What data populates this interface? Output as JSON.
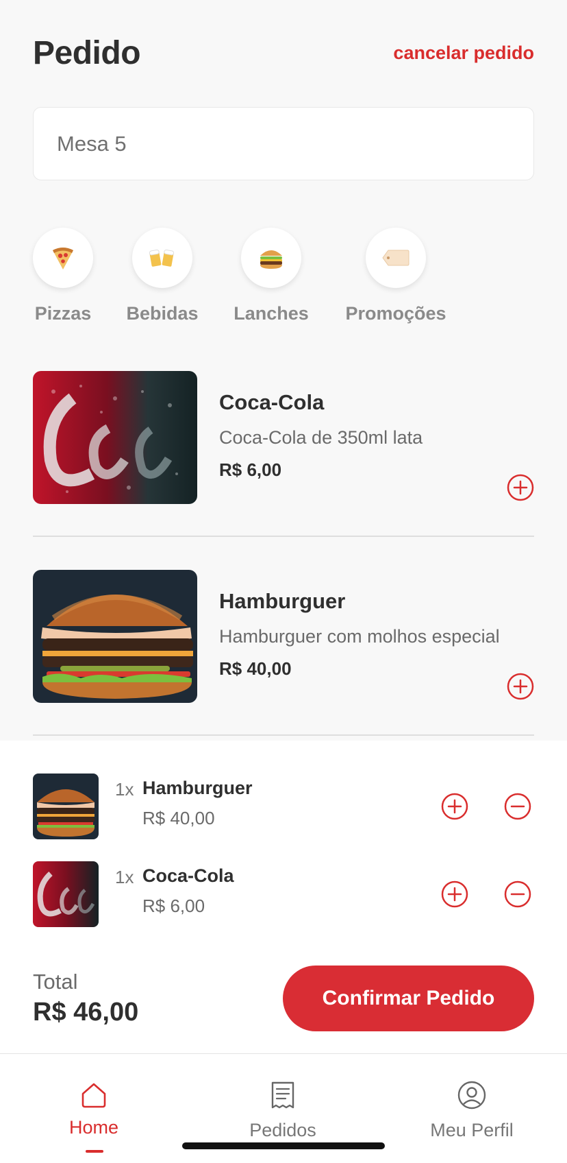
{
  "header": {
    "title": "Pedido",
    "cancel_label": "cancelar pedido"
  },
  "table_field": {
    "value": "Mesa 5"
  },
  "categories": [
    {
      "label": "Pizzas",
      "icon": "pizza-icon"
    },
    {
      "label": "Bebidas",
      "icon": "beer-mugs-icon"
    },
    {
      "label": "Lanches",
      "icon": "burger-icon"
    },
    {
      "label": "Promoções",
      "icon": "tag-icon"
    }
  ],
  "products": [
    {
      "name": "Coca-Cola",
      "description": "Coca-Cola de 350ml lata",
      "price": "R$ 6,00",
      "image": "coca-cola-can-image"
    },
    {
      "name": "Hamburguer",
      "description": "Hamburguer com molhos especial",
      "price": "R$ 40,00",
      "image": "hamburger-image"
    }
  ],
  "cart": {
    "items": [
      {
        "qty": "1x",
        "name": "Hamburguer",
        "price": "R$ 40,00"
      },
      {
        "qty": "1x",
        "name": "Coca-Cola",
        "price": "R$ 6,00"
      }
    ],
    "total_label": "Total",
    "total_value": "R$ 46,00",
    "confirm_label": "Confirmar Pedido"
  },
  "navbar": {
    "items": [
      {
        "label": "Home",
        "icon": "home-icon",
        "active": true
      },
      {
        "label": "Pedidos",
        "icon": "receipt-icon",
        "active": false
      },
      {
        "label": "Meu Perfil",
        "icon": "user-circle-icon",
        "active": false
      }
    ]
  },
  "colors": {
    "accent": "#d92d2d",
    "background": "#f8f8f8",
    "text": "#2f2f2f"
  }
}
